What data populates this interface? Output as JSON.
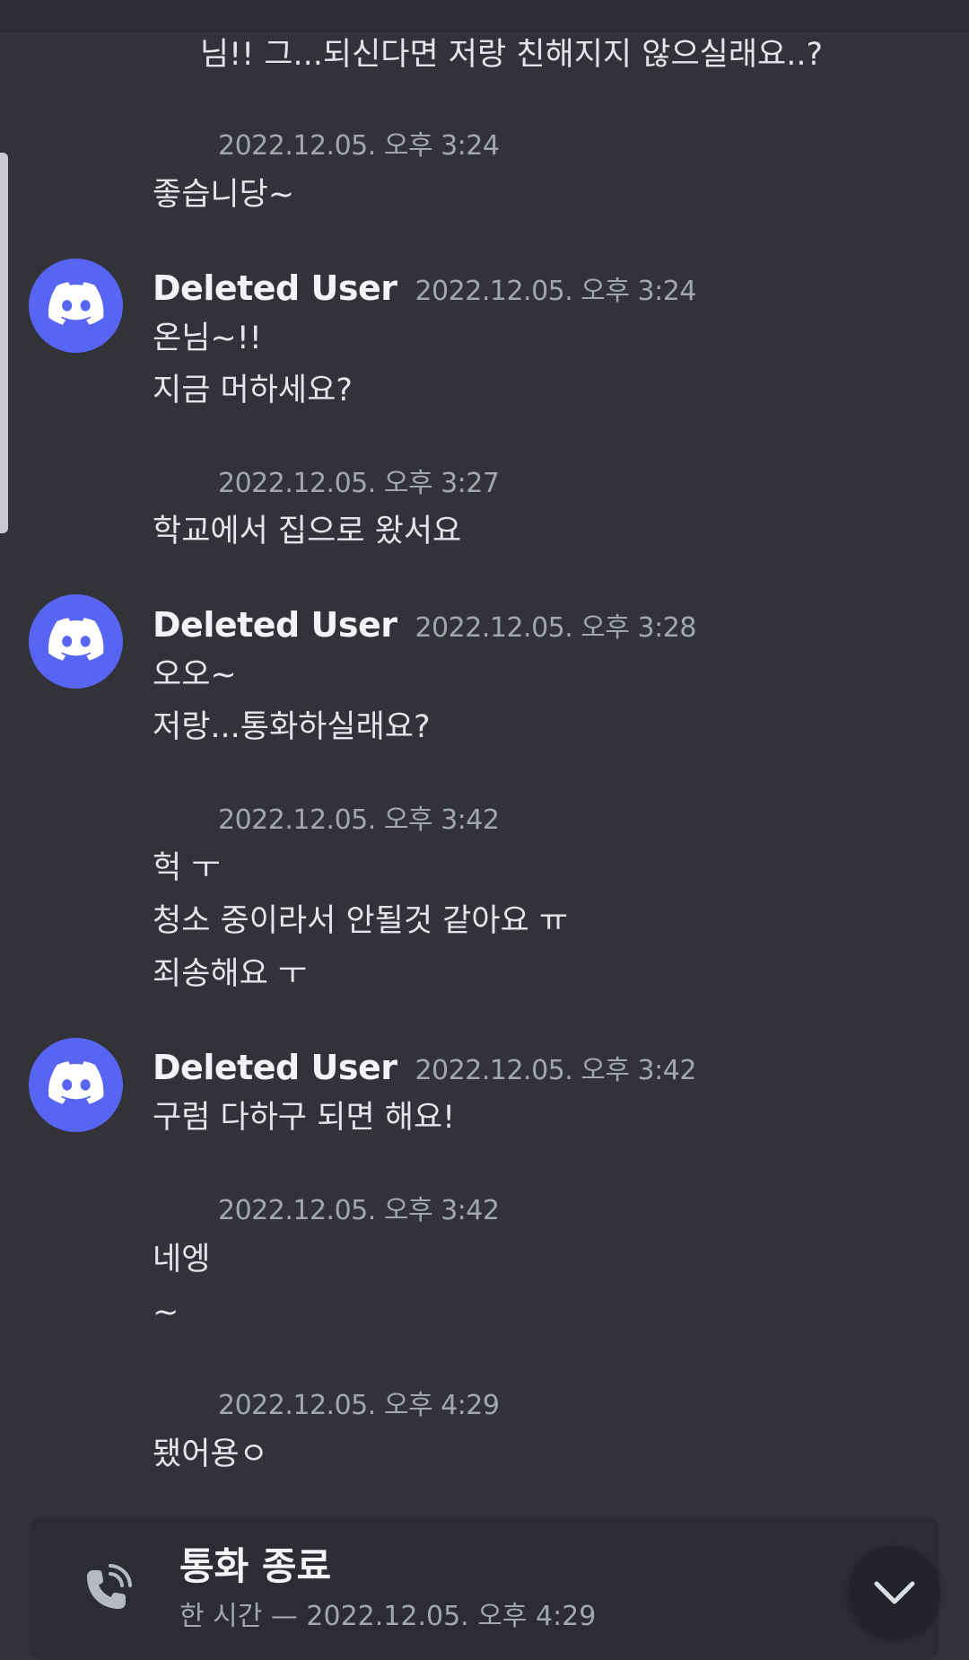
{
  "partial_message": "님!! 그...되신다면 저랑 친해지지 않으실래요..?",
  "messages": [
    {
      "type": "compact",
      "time": "2022.12.05. 오후 3:24",
      "lines": [
        "좋습니당~"
      ]
    },
    {
      "type": "full",
      "author": "Deleted User",
      "time": "2022.12.05. 오후 3:24",
      "lines": [
        "온님~!!",
        "지금 머하세요?"
      ]
    },
    {
      "type": "compact",
      "time": "2022.12.05. 오후 3:27",
      "lines": [
        "학교에서 집으로 왔서요"
      ]
    },
    {
      "type": "full",
      "author": "Deleted User",
      "time": "2022.12.05. 오후 3:28",
      "lines": [
        "오오~",
        "저랑...통화하실래요?"
      ]
    },
    {
      "type": "compact",
      "time": "2022.12.05. 오후 3:42",
      "lines": [
        "헉 ㅜ",
        "청소 중이라서 안될것 같아요 ㅠ",
        "죄송해요 ㅜ"
      ]
    },
    {
      "type": "full",
      "author": "Deleted User",
      "time": "2022.12.05. 오후 3:42",
      "lines": [
        "구럼 다하구 되면 해요!"
      ]
    },
    {
      "type": "compact",
      "time": "2022.12.05. 오후 3:42",
      "lines": [
        "네엥",
        "~"
      ]
    },
    {
      "type": "compact",
      "time": "2022.12.05. 오후 4:29",
      "lines": [
        "됐어용ㅇ"
      ]
    }
  ],
  "call": {
    "title": "통화 종료",
    "subtitle": "한 시간 — 2022.12.05. 오후 4:29",
    "icon": "phone-call-ended-icon"
  },
  "jump_button_icon": "chevron-down-icon",
  "colors": {
    "background": "#313338",
    "avatar": "#5865f2",
    "timestamp": "#a3a6aa",
    "text": "#e3e5e8"
  }
}
